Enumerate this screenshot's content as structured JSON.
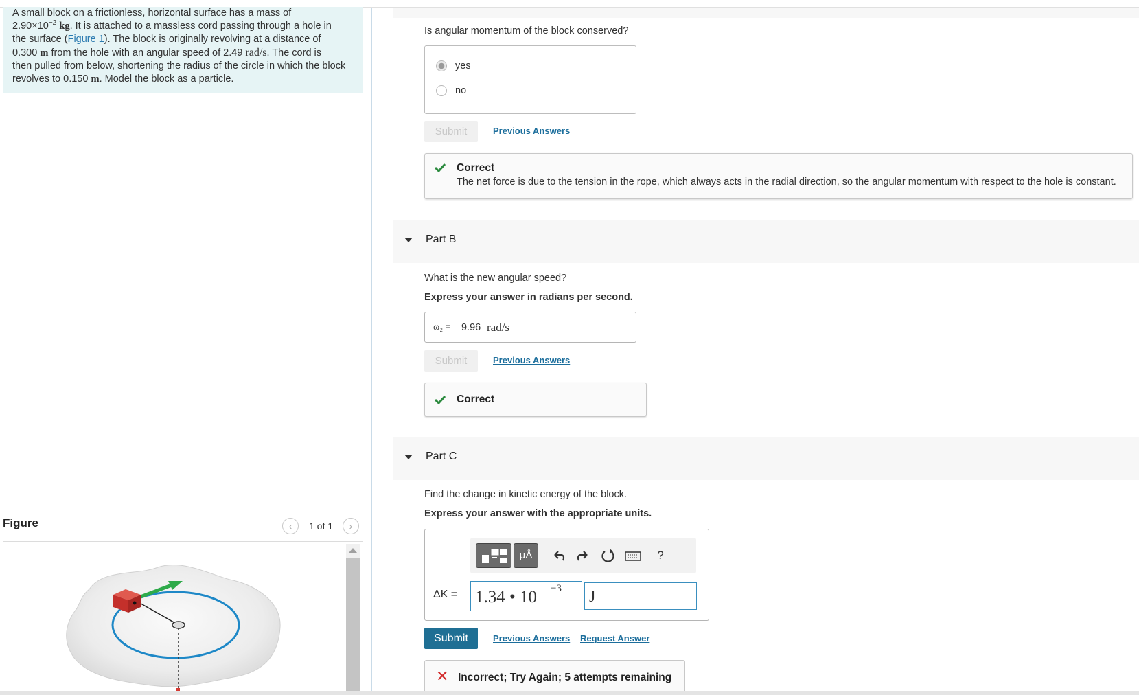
{
  "problem": {
    "line1": "A small block on a frictionless, horizontal surface has a mass of",
    "mass_mantissa": "2.90×10",
    "mass_exp": "−2",
    "mass_unit": "kg",
    "line2_rest": ". It is attached to a massless cord passing through a hole in",
    "line3_pre": "the surface (",
    "figure_link": "Figure 1",
    "line3_post": "). The block is originally revolving at a distance of",
    "dist_value": "0.300",
    "dist_unit": "m",
    "line4_mid": " from the hole with an angular speed of 2.49 ",
    "speed_unit": "rad/s",
    "line4_post": ". The cord is",
    "line5": "then pulled from below, shortening the radius of the circle in which the block",
    "line6_pre": "revolves to 0.150 ",
    "line6_unit": "m",
    "line6_post": ". Model the block as a particle."
  },
  "figure": {
    "title": "Figure",
    "pager": "1 of 1",
    "prev_icon": "chevron-left-icon",
    "next_icon": "chevron-right-icon",
    "colors": {
      "surface": "#e9e9e9",
      "circle": "#1e88c7",
      "block": "#d63a34",
      "arrow": "#2eaa4a"
    }
  },
  "partA": {
    "question": "Is angular momentum of the block conserved?",
    "options": [
      {
        "label": "yes",
        "selected": true
      },
      {
        "label": "no",
        "selected": false
      }
    ],
    "submit_label": "Submit",
    "previous_answers": "Previous Answers",
    "feedback_title": "Correct",
    "feedback_body": "The net force is due to the tension in the rope, which always acts in the radial direction, so the angular momentum with respect to the hole is constant."
  },
  "partB": {
    "header": "Part B",
    "question": "What is the new angular speed?",
    "instruction": "Express your answer in radians per second.",
    "answer_symbol": "ω₂ =",
    "answer_value": "9.96",
    "answer_unit": "rad/s",
    "submit_label": "Submit",
    "previous_answers": "Previous Answers",
    "feedback_title": "Correct"
  },
  "partC": {
    "header": "Part C",
    "question": "Find the change in kinetic energy of the block.",
    "instruction": "Express your answer with the appropriate units.",
    "toolbar": {
      "templates_icon": "templates-icon",
      "units_label": "μÅ",
      "undo_icon": "undo-icon",
      "redo_icon": "redo-icon",
      "reset_icon": "reset-icon",
      "keyboard_icon": "keyboard-icon",
      "help_label": "?"
    },
    "answer_label": "ΔK =",
    "answer_value": "1.34 • 10",
    "answer_exponent": "−3",
    "answer_unit": "J",
    "submit_label": "Submit",
    "previous_answers": "Previous Answers",
    "request_answer": "Request Answer",
    "feedback_title": "Incorrect; Try Again; 5 attempts remaining",
    "colors": {
      "submit": "#1f6f94",
      "error": "#d32c2c",
      "correct": "#2b8a3e"
    }
  }
}
